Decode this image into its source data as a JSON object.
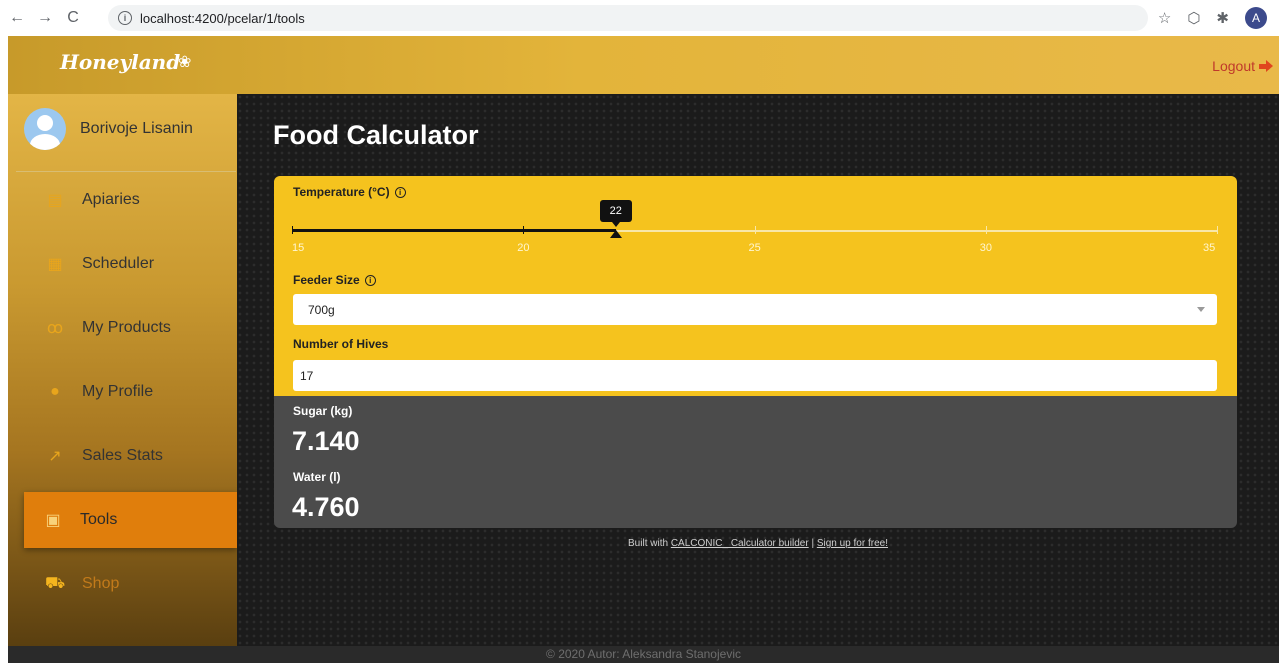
{
  "browser": {
    "back": "←",
    "forward": "→",
    "reload": "C",
    "url": "localhost:4200/pcelar/1/tools",
    "profile_initial": "A"
  },
  "header": {
    "logo": "Honeyland",
    "logout_label": "Logout"
  },
  "sidebar": {
    "user_name": "Borivoje Lisanin",
    "items": [
      {
        "label": "Apiaries",
        "icon": "hive-icon"
      },
      {
        "label": "Scheduler",
        "icon": "calendar-icon"
      },
      {
        "label": "My Products",
        "icon": "products-icon"
      },
      {
        "label": "My Profile",
        "icon": "person-icon"
      },
      {
        "label": "Sales Stats",
        "icon": "chart-icon"
      },
      {
        "label": "Tools",
        "icon": "calculator-icon",
        "active": true
      },
      {
        "label": "Shop",
        "icon": "cart-icon"
      }
    ]
  },
  "main": {
    "title": "Food Calculator",
    "temperature": {
      "label": "Temperature (°C)",
      "min": 15,
      "max": 35,
      "value": "22",
      "ticks": [
        "15",
        "20",
        "25",
        "30",
        "35"
      ]
    },
    "feeder": {
      "label": "Feeder Size",
      "selected": "700g"
    },
    "hives": {
      "label": "Number of Hives",
      "value": "17"
    },
    "results": {
      "sugar_label": "Sugar (kg)",
      "sugar_value": "7.140",
      "water_label": "Water (l)",
      "water_value": "4.760"
    },
    "credit": {
      "prefix": "Built with",
      "link": "CALCONIC_ Calculator builder",
      "separator": "|",
      "signup": "Sign up for free!"
    }
  },
  "footer": {
    "text": "© 2020 Autor: Aleksandra Stanojevic"
  },
  "colors": {
    "accent": "#f5c31e",
    "active_item": "#e07e0c",
    "result_panel": "#4b4b4b",
    "logout": "#c0392b"
  }
}
